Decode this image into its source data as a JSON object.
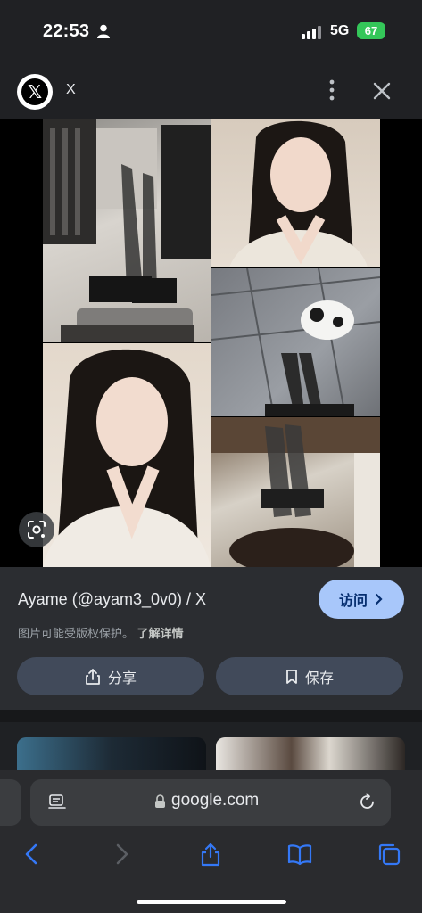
{
  "status_bar": {
    "time": "22:53",
    "network": "5G",
    "battery": "67",
    "person_icon": "person-icon",
    "signal_icon": "cellular-signal-icon"
  },
  "header": {
    "logo_glyph": "𝕏",
    "title": "X",
    "more_icon": "more-vertical-icon",
    "close_icon": "close-icon"
  },
  "image": {
    "lens_icon": "google-lens-icon"
  },
  "result": {
    "title": "Ayame (@ayam3_0v0) / X",
    "visit_label": "访问",
    "copyright_text": "图片可能受版权保护。",
    "learn_more": "了解详情",
    "share_label": "分享",
    "save_label": "保存"
  },
  "browser": {
    "url": "google.com",
    "toolbar_icons": [
      "back-icon",
      "forward-icon",
      "share-icon",
      "bookmarks-icon",
      "tabs-icon"
    ]
  },
  "colors": {
    "accent": "#a8c7fa",
    "toolbar_blue": "#3478f6",
    "battery_green": "#34c759"
  }
}
